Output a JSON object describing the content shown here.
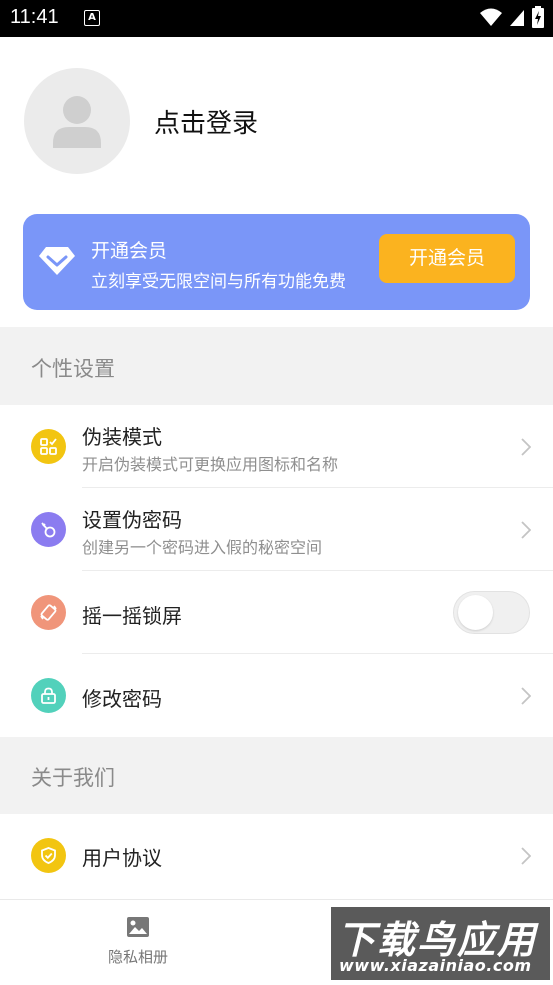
{
  "status_bar": {
    "time": "11:41",
    "notification_icon": "a-icon"
  },
  "profile": {
    "login_text": "点击登录"
  },
  "vip": {
    "title": "开通会员",
    "subtitle": "立刻享受无限空间与所有功能免费",
    "button_label": "开通会员",
    "card_color": "#7a96f8",
    "button_color": "#fbb31f"
  },
  "sections": {
    "personal": {
      "header": "个性设置",
      "items": [
        {
          "title": "伪装模式",
          "subtitle": "开启伪装模式可更换应用图标和名称",
          "icon": "grid-check-icon",
          "color": "#f2c511"
        },
        {
          "title": "设置伪密码",
          "subtitle": "创建另一个密码进入假的秘密空间",
          "icon": "key-icon",
          "color": "#8b7cf0"
        },
        {
          "title": "摇一摇锁屏",
          "icon": "shake-phone-icon",
          "color": "#f0957a",
          "toggle_on": false
        },
        {
          "title": "修改密码",
          "icon": "lock-icon",
          "color": "#52d1bb"
        }
      ]
    },
    "about": {
      "header": "关于我们",
      "items": [
        {
          "title": "用户协议",
          "icon": "shield-check-icon",
          "color": "#f2c511"
        }
      ]
    }
  },
  "tabbar": {
    "tabs": [
      {
        "label": "隐私相册",
        "icon": "image-icon"
      }
    ]
  },
  "watermark": {
    "main": "下载鸟应用",
    "url": "www.xiazainiao.com"
  }
}
